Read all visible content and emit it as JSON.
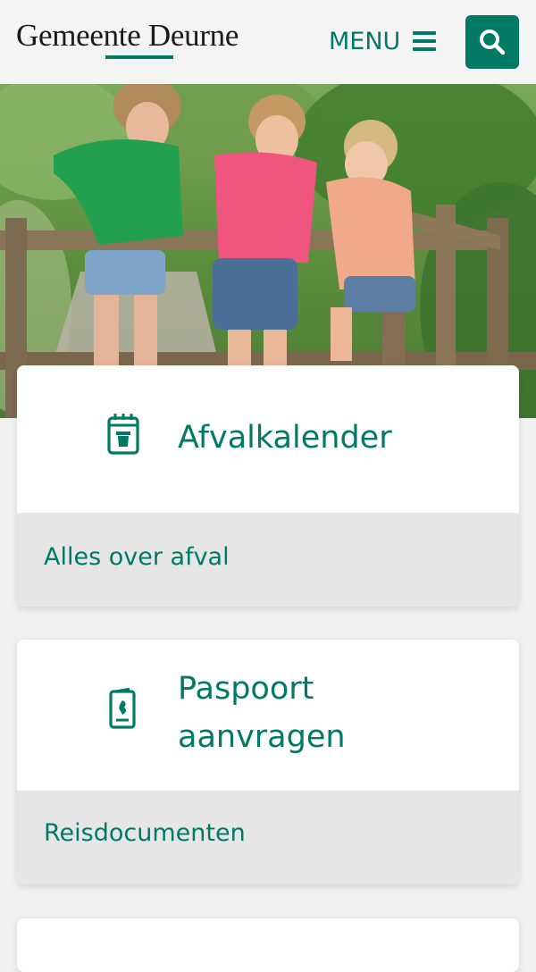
{
  "header": {
    "logo_text": "Gemeente Deurne",
    "menu_label": "MENU",
    "menu_icon": "hamburger-icon",
    "search_icon": "search-icon"
  },
  "colors": {
    "brand": "#007a64",
    "card_footer": "#e6e6e6",
    "background": "#f1f1f1"
  },
  "cards": [
    {
      "title": "Afvalkalender",
      "icon": "calendar-trash-icon",
      "link": "Alles over afval"
    },
    {
      "title_line1": "Paspoort",
      "title_line2": "aanvragen",
      "icon": "passport-icon",
      "link": "Reisdocumenten"
    }
  ]
}
